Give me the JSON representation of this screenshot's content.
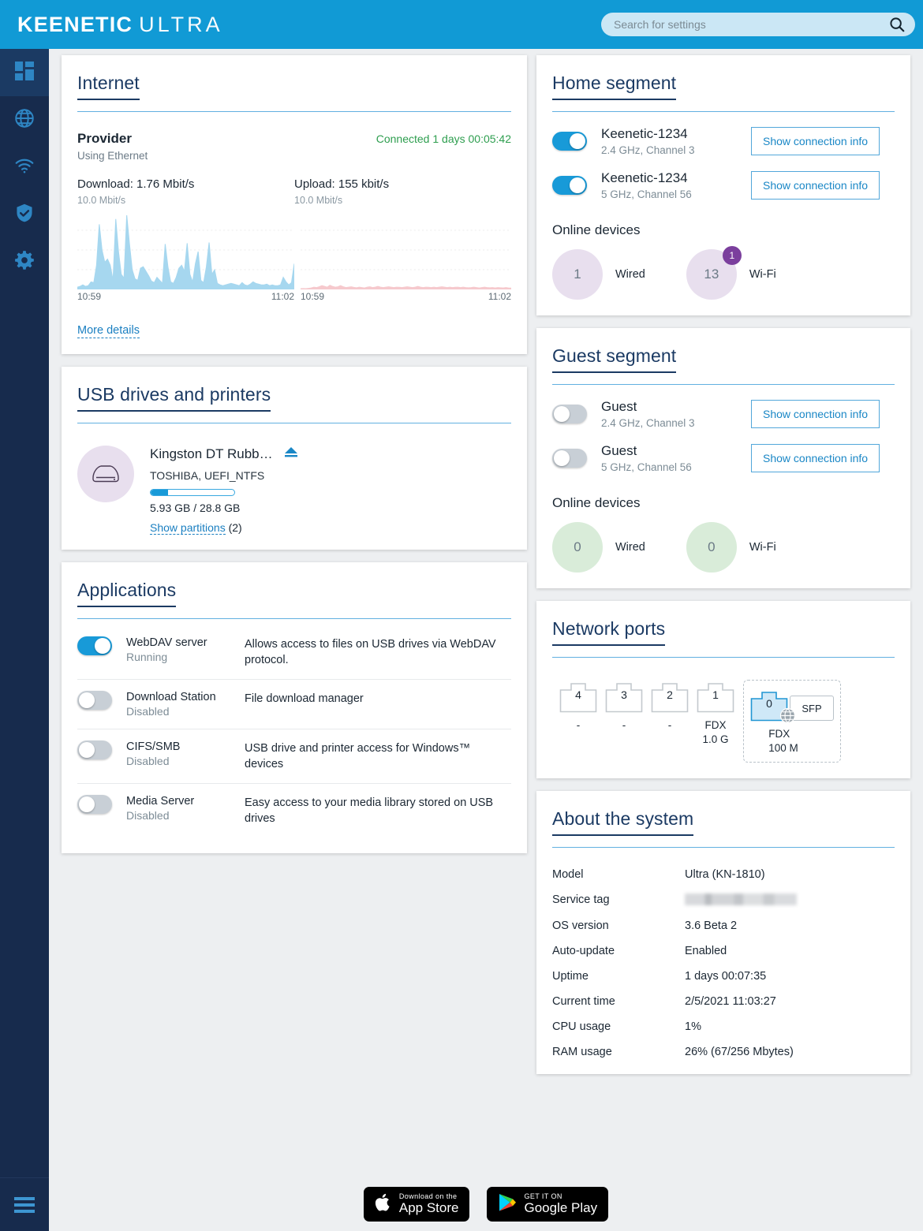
{
  "header": {
    "logo_bold": "KEENETIC",
    "logo_light": "ULTRA",
    "search_placeholder": "Search for settings",
    "search_value": "",
    "bg_color": "#119ad5"
  },
  "sidebar": {
    "items": [
      {
        "name": "dashboard",
        "icon": "grid-icon",
        "active": true
      },
      {
        "name": "internet",
        "icon": "globe-icon",
        "active": false
      },
      {
        "name": "wireless",
        "icon": "wifi-icon",
        "active": false
      },
      {
        "name": "security",
        "icon": "shield-check-icon",
        "active": false
      },
      {
        "name": "management",
        "icon": "gear-icon",
        "active": false
      }
    ],
    "menu_icon": "hamburger-icon",
    "bg_color": "#172b4d"
  },
  "internet": {
    "title": "Internet",
    "provider_label": "Provider",
    "provider_sub": "Using Ethernet",
    "status": "Connected 1 days 00:05:42",
    "status_color": "#2e9e4f",
    "download_label": "Download: 1.76 Mbit/s",
    "download_max": "10.0 Mbit/s",
    "upload_label": "Upload: 155 kbit/s",
    "upload_max": "10.0 Mbit/s",
    "axis_start": "10:59",
    "axis_end": "11:02",
    "more_details": "More details"
  },
  "chart_data": [
    {
      "type": "area",
      "title": "Download",
      "ylabel": "Mbit/s",
      "ylim": [
        0,
        10.0
      ],
      "xlabel": "",
      "x": [
        "10:59",
        "11:02"
      ],
      "tick_labels": [
        "10:59",
        "11:02"
      ],
      "grid": true,
      "color": "#a6d7ef",
      "values": [
        0.3,
        0.4,
        0.6,
        0.4,
        0.5,
        1.0,
        0.9,
        3.2,
        8.6,
        5.2,
        3.6,
        4.0,
        3.2,
        1.2,
        9.3,
        5.0,
        2.0,
        1.5,
        9.8,
        6.0,
        2.6,
        1.4,
        1.2,
        2.8,
        3.0,
        2.4,
        1.8,
        1.1,
        0.9,
        1.6,
        1.2,
        0.8,
        6.0,
        3.0,
        1.0,
        0.8,
        1.6,
        2.8,
        3.2,
        2.4,
        6.1,
        2.0,
        1.0,
        3.4,
        5.0,
        1.2,
        0.9,
        3.0,
        6.2,
        2.0,
        2.6,
        0.8,
        0.6,
        0.5,
        0.6,
        0.7,
        0.8,
        0.7,
        0.6,
        0.5,
        0.9,
        0.6,
        0.5,
        0.7,
        1.0,
        0.8,
        0.7,
        0.6,
        0.6,
        0.7,
        0.5,
        0.6,
        0.5,
        0.5,
        0.6,
        1.6,
        1.0,
        0.6,
        0.9,
        3.4
      ]
    },
    {
      "type": "area",
      "title": "Upload",
      "ylabel": "Mbit/s",
      "ylim": [
        0,
        10.0
      ],
      "xlabel": "",
      "x": [
        "10:59",
        "11:02"
      ],
      "tick_labels": [
        "10:59",
        "11:02"
      ],
      "grid": true,
      "color": "#f6c9cd",
      "values": [
        0.1,
        0.12,
        0.1,
        0.15,
        0.2,
        0.3,
        0.25,
        0.35,
        0.5,
        0.4,
        0.3,
        0.55,
        0.4,
        0.3,
        0.35,
        0.5,
        0.35,
        0.25,
        0.3,
        0.35,
        0.28,
        0.22,
        0.3,
        0.25,
        0.2,
        0.3,
        0.35,
        0.25,
        0.3,
        0.4,
        0.3,
        0.25,
        0.3,
        0.35,
        0.3,
        0.25,
        0.3,
        0.28,
        0.25,
        0.3,
        0.35,
        0.3,
        0.25,
        0.3,
        0.4,
        0.3,
        0.25,
        0.3,
        0.28,
        0.25,
        0.3,
        0.25,
        0.3,
        0.35,
        0.3,
        0.25,
        0.3,
        0.25,
        0.28,
        0.3,
        0.25,
        0.3,
        0.25,
        0.22,
        0.25,
        0.3,
        0.25,
        0.2,
        0.25,
        0.3,
        0.25,
        0.22,
        0.25,
        0.2,
        0.25,
        0.22,
        0.2,
        0.25,
        0.2,
        0.18
      ]
    }
  ],
  "usb": {
    "title": "USB drives and printers",
    "drive_name": "Kingston DT Rubb…",
    "drive_sub": "TOSHIBA, UEFI_NTFS",
    "usage_percent": 21,
    "usage_text": "5.93 GB / 28.8 GB",
    "partitions_link": "Show partitions",
    "partitions_count": "(2)",
    "disk_icon": "hard-drive-icon",
    "eject_icon": "eject-icon"
  },
  "applications": {
    "title": "Applications",
    "items": [
      {
        "name": "WebDAV server",
        "state": "Running",
        "enabled": true,
        "description": "Allows access to files on USB drives via WebDAV protocol."
      },
      {
        "name": "Download Station",
        "state": "Disabled",
        "enabled": false,
        "description": "File download manager"
      },
      {
        "name": "CIFS/SMB",
        "state": "Disabled",
        "enabled": false,
        "description": "USB drive and printer access for Windows™ devices"
      },
      {
        "name": "Media Server",
        "state": "Disabled",
        "enabled": false,
        "description": "Easy access to your media library stored on USB drives"
      }
    ]
  },
  "home_segment": {
    "title": "Home segment",
    "networks": [
      {
        "ssid": "Keenetic-1234",
        "band": "2.4 GHz, Channel 3",
        "enabled": true,
        "button": "Show connection info"
      },
      {
        "ssid": "Keenetic-1234",
        "band": "5 GHz, Channel 56",
        "enabled": true,
        "button": "Show connection info"
      }
    ],
    "online_label": "Online devices",
    "devices": [
      {
        "count": "1",
        "label": "Wired",
        "badge": null,
        "color": "#e8dfee"
      },
      {
        "count": "13",
        "label": "Wi-Fi",
        "badge": "1",
        "color": "#e8dfee"
      }
    ],
    "badge_color": "#7b3f9d"
  },
  "guest_segment": {
    "title": "Guest segment",
    "networks": [
      {
        "ssid": "Guest",
        "band": "2.4 GHz, Channel 3",
        "enabled": false,
        "button": "Show connection info"
      },
      {
        "ssid": "Guest",
        "band": "5 GHz, Channel 56",
        "enabled": false,
        "button": "Show connection info"
      }
    ],
    "online_label": "Online devices",
    "devices": [
      {
        "count": "0",
        "label": "Wired",
        "badge": null,
        "color": "#d9ecd9"
      },
      {
        "count": "0",
        "label": "Wi-Fi",
        "badge": null,
        "color": "#d9ecd9"
      }
    ]
  },
  "network_ports": {
    "title": "Network ports",
    "ports": [
      {
        "number": "4",
        "status": "-",
        "speed": "",
        "active": false
      },
      {
        "number": "3",
        "status": "-",
        "speed": "",
        "active": false
      },
      {
        "number": "2",
        "status": "-",
        "speed": "",
        "active": false
      },
      {
        "number": "1",
        "status": "FDX",
        "speed": "1.0 G",
        "active": false
      }
    ],
    "wan_group": {
      "number": "0",
      "status": "FDX",
      "speed": "100 M",
      "active": true,
      "sfp_label": "SFP",
      "globe_icon": "globe-icon"
    }
  },
  "about_system": {
    "title": "About the system",
    "rows": [
      {
        "key": "Model",
        "value": "Ultra (KN-1810)",
        "redacted": false
      },
      {
        "key": "Service tag",
        "value": "",
        "redacted": true
      },
      {
        "key": "OS version",
        "value": "3.6 Beta 2",
        "redacted": false
      },
      {
        "key": "Auto-update",
        "value": "Enabled",
        "redacted": false
      },
      {
        "key": "Uptime",
        "value": "1 days 00:07:35",
        "redacted": false
      },
      {
        "key": "Current time",
        "value": "2/5/2021 11:03:27",
        "redacted": false
      },
      {
        "key": "CPU usage",
        "value": "1%",
        "redacted": false
      },
      {
        "key": "RAM usage",
        "value": "26% (67/256 Mbytes)",
        "redacted": false
      }
    ]
  },
  "footer": {
    "appstore_small": "Download on the",
    "appstore_big": "App Store",
    "googleplay_small": "GET IT ON",
    "googleplay_big": "Google Play"
  }
}
